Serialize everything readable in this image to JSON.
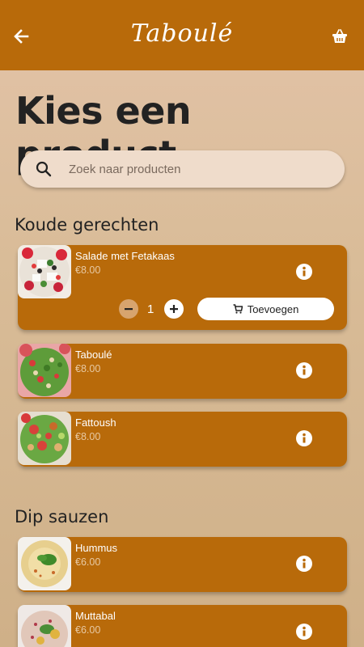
{
  "appbar": {
    "title": "Taboulé"
  },
  "page": {
    "title": "Kies een product"
  },
  "search": {
    "placeholder": "Zoek naar producten"
  },
  "sections": [
    {
      "title": "Koude gerechten",
      "products": [
        {
          "name": "Salade met Fetakaas",
          "price": "€8.00",
          "quantity": "1",
          "add_label": "Toevoegen"
        },
        {
          "name": "Taboulé",
          "price": "€8.00"
        },
        {
          "name": "Fattoush",
          "price": "€8.00"
        }
      ]
    },
    {
      "title": "Dip sauzen",
      "products": [
        {
          "name": "Hummus",
          "price": "€6.00"
        },
        {
          "name": "Muttabal",
          "price": "€6.00"
        }
      ]
    }
  ],
  "colors": {
    "accent": "#b86a0a",
    "search_bg": "#efdccb"
  }
}
